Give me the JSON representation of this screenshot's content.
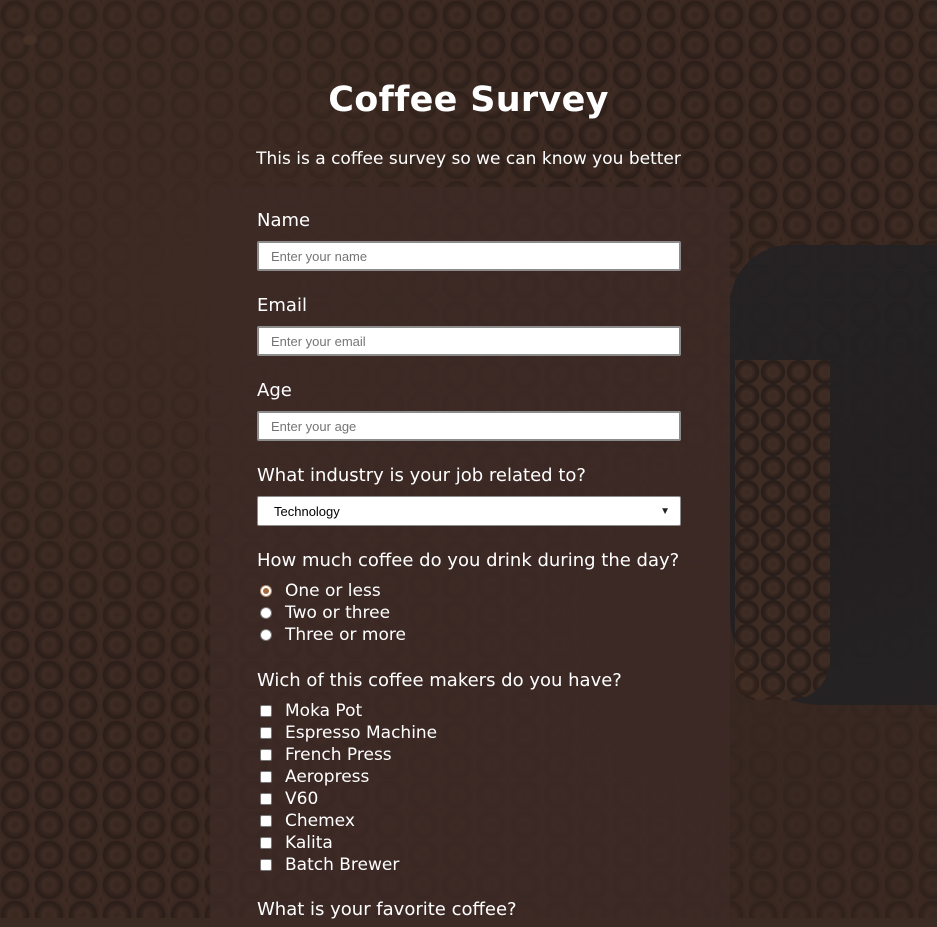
{
  "header": {
    "title": "Coffee Survey",
    "subtitle": "This is a coffee survey so we can know you better"
  },
  "form": {
    "name": {
      "label": "Name",
      "placeholder": "Enter your name",
      "value": ""
    },
    "email": {
      "label": "Email",
      "placeholder": "Enter your email",
      "value": ""
    },
    "age": {
      "label": "Age",
      "placeholder": "Enter your age",
      "value": ""
    },
    "industry": {
      "label": "What industry is your job related to?",
      "selected": "Technology"
    },
    "coffee_amount": {
      "label": "How much coffee do you drink during the day?",
      "options": [
        {
          "label": "One or less",
          "checked": true
        },
        {
          "label": "Two or three",
          "checked": false
        },
        {
          "label": "Three or more",
          "checked": false
        }
      ]
    },
    "coffee_makers": {
      "label": "Wich of this coffee makers do you have?",
      "options": [
        {
          "label": "Moka Pot",
          "checked": false
        },
        {
          "label": "Espresso Machine",
          "checked": false
        },
        {
          "label": "French Press",
          "checked": false
        },
        {
          "label": "Aeropress",
          "checked": false
        },
        {
          "label": "V60",
          "checked": false
        },
        {
          "label": "Chemex",
          "checked": false
        },
        {
          "label": "Kalita",
          "checked": false
        },
        {
          "label": "Batch Brewer",
          "checked": false
        }
      ]
    },
    "favorite": {
      "label": "What is your favorite coffee?"
    }
  },
  "icons": {
    "select_chevron": "chevron-down-icon"
  },
  "colors": {
    "radio_accent": "#a5683a",
    "card_background": "rgba(62,42,38,0.78)"
  }
}
